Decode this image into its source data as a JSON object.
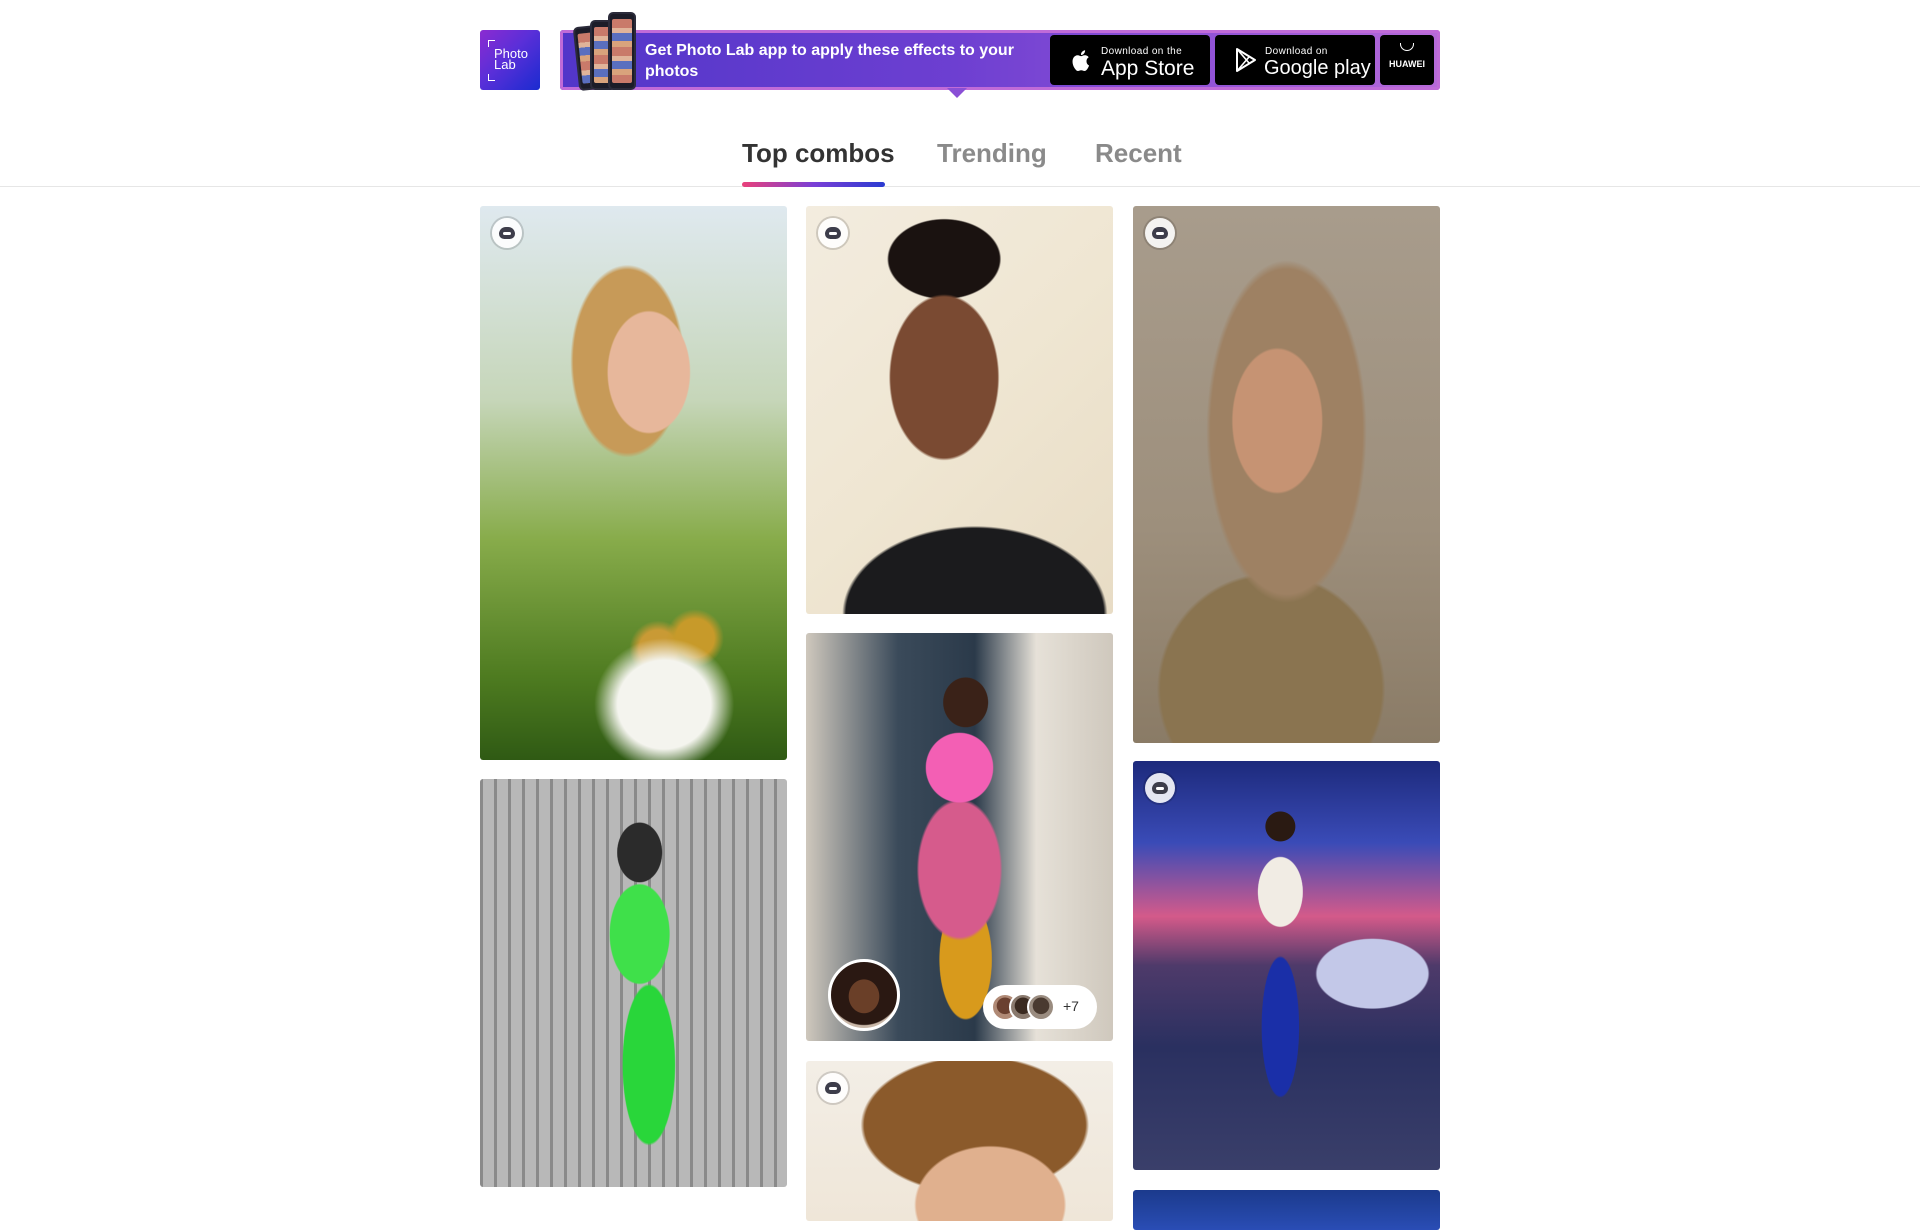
{
  "logo": {
    "line1": "Photo",
    "line2": "Lab"
  },
  "promo": {
    "text": "Get Photo Lab app to apply these effects to your photos",
    "app_store": {
      "small": "Download on the",
      "big": "App Store"
    },
    "google_play": {
      "small": "Download on",
      "big": "Google play"
    },
    "huawei": {
      "label": "HUAWEI"
    }
  },
  "tabs": [
    {
      "label": "Top combos",
      "active": true
    },
    {
      "label": "Trending",
      "active": false
    },
    {
      "label": "Recent",
      "active": false
    }
  ],
  "cards": [
    {
      "description": "Woman with braid and birds on blossoming branch",
      "badge": "template-icon"
    },
    {
      "description": "Cartoon portrait of smiling man",
      "badge": "template-icon"
    },
    {
      "description": "Woman in beige hijab with gold jewelry",
      "badge": "template-icon"
    },
    {
      "description": "Black and white photo, person in bright green outfit",
      "badge": "none"
    },
    {
      "description": "Woman in pink coat and mustard pants",
      "badge": "none",
      "remix_count": "+7"
    },
    {
      "description": "Man standing before car under night sky",
      "badge": "template-icon"
    },
    {
      "description": "Cartoon portrait close-up",
      "badge": "template-icon"
    },
    {
      "description": "Blue image",
      "badge": "none"
    }
  ],
  "colors": {
    "accent_gradient": [
      "#e9407a",
      "#7a3fd6",
      "#2a3bd1"
    ],
    "promo_bg": "#6d3fd1",
    "active_tab": "#333333",
    "inactive_tab": "#8a8a8a"
  }
}
